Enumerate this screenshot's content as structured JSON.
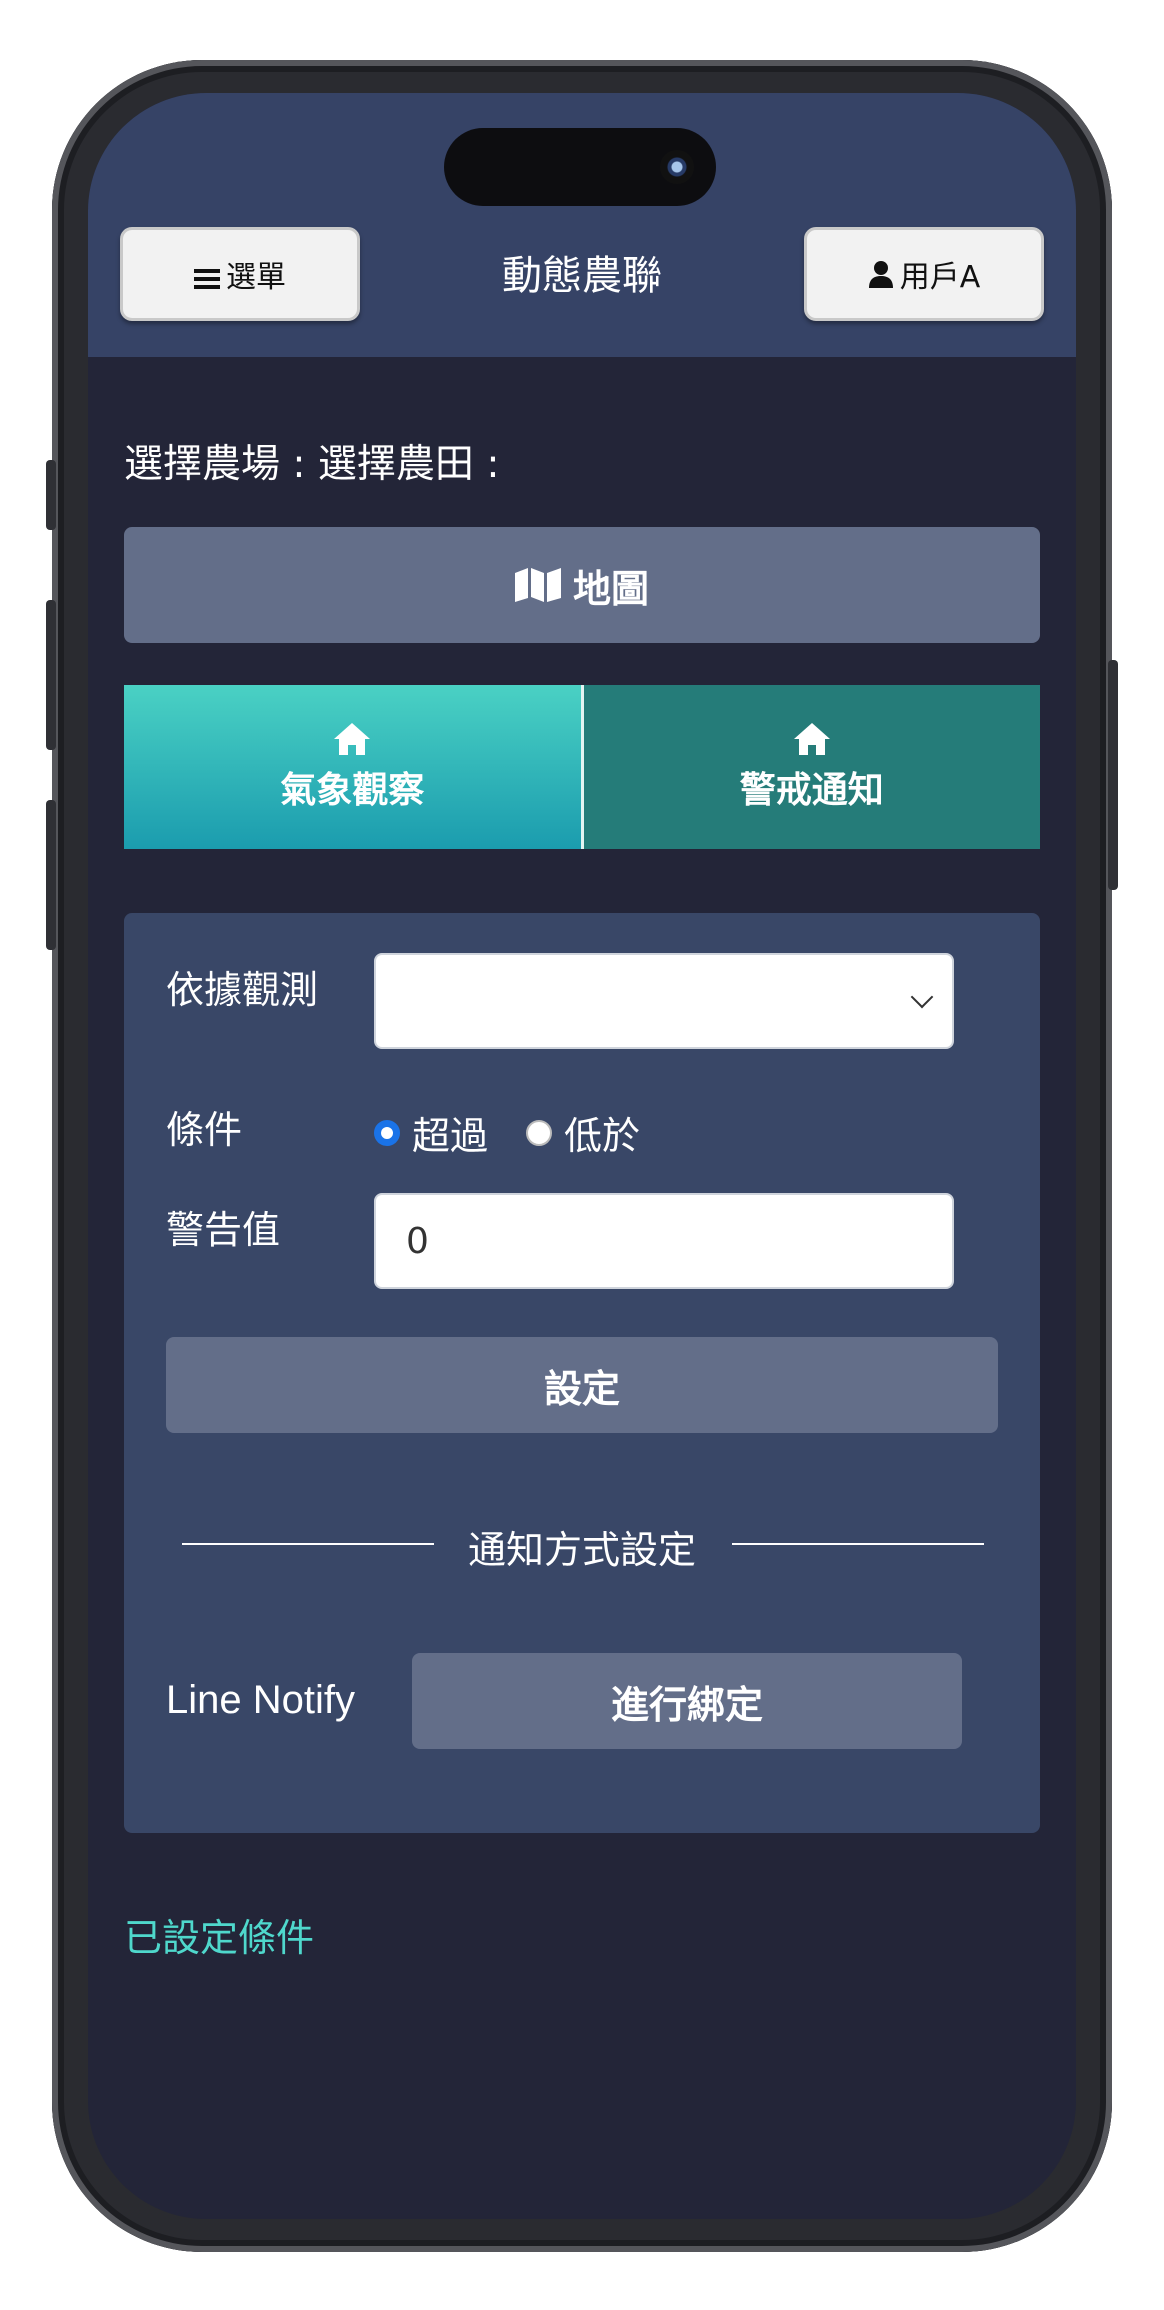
{
  "header": {
    "menu_label": "選單",
    "title": "動態農聯",
    "user_label": "用戶A"
  },
  "selector": {
    "text": "選擇農場 : 選擇農田 :"
  },
  "map_button": {
    "label": "地圖",
    "icon": "map-icon"
  },
  "tabs": [
    {
      "label": "氣象觀察",
      "icon": "home-icon",
      "active": true
    },
    {
      "label": "警戒通知",
      "icon": "home-icon",
      "active": false
    }
  ],
  "form": {
    "basis_label": "依據觀測",
    "basis_value": "",
    "condition_label": "條件",
    "condition_options": [
      "超過",
      "低於"
    ],
    "condition_selected": "超過",
    "warning_label": "警告值",
    "warning_value": "0",
    "submit_label": "設定"
  },
  "notify": {
    "section_title": "通知方式設定",
    "line_label": "Line Notify",
    "bind_label": "進行綁定"
  },
  "set_conditions_label": "已設定條件",
  "colors": {
    "header_bg": "#364366",
    "page_bg": "#232538",
    "panel_bg": "#394767",
    "button_bg": "#636e89",
    "tab_active_top": "#4ad1c4",
    "tab_active_bottom": "#1b9cae",
    "tab_inactive": "#257c79",
    "accent_text": "#4fd8cc"
  }
}
